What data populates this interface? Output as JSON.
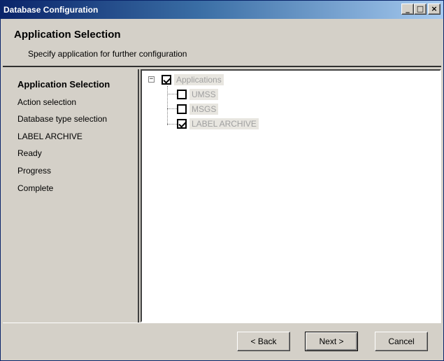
{
  "window": {
    "title": "Database Configuration"
  },
  "titlebar_buttons": {
    "minimize": "_",
    "maximize": "□",
    "close": "×"
  },
  "header": {
    "title": "Application Selection",
    "subtitle": "Specify application for further configuration"
  },
  "sidebar": {
    "steps": [
      {
        "label": "Application Selection",
        "active": true
      },
      {
        "label": "Action selection",
        "active": false
      },
      {
        "label": "Database type selection",
        "active": false
      },
      {
        "label": "LABEL ARCHIVE",
        "active": false
      },
      {
        "label": "Ready",
        "active": false
      },
      {
        "label": "Progress",
        "active": false
      },
      {
        "label": "Complete",
        "active": false
      }
    ]
  },
  "tree": {
    "root": {
      "label": "Applications",
      "checked": true,
      "expander": "−"
    },
    "children": [
      {
        "label": "UMSS",
        "checked": false
      },
      {
        "label": "MSGS",
        "checked": false
      },
      {
        "label": "LABEL ARCHIVE",
        "checked": true
      }
    ]
  },
  "buttons": {
    "back": "< Back",
    "next": "Next >",
    "cancel": "Cancel"
  }
}
